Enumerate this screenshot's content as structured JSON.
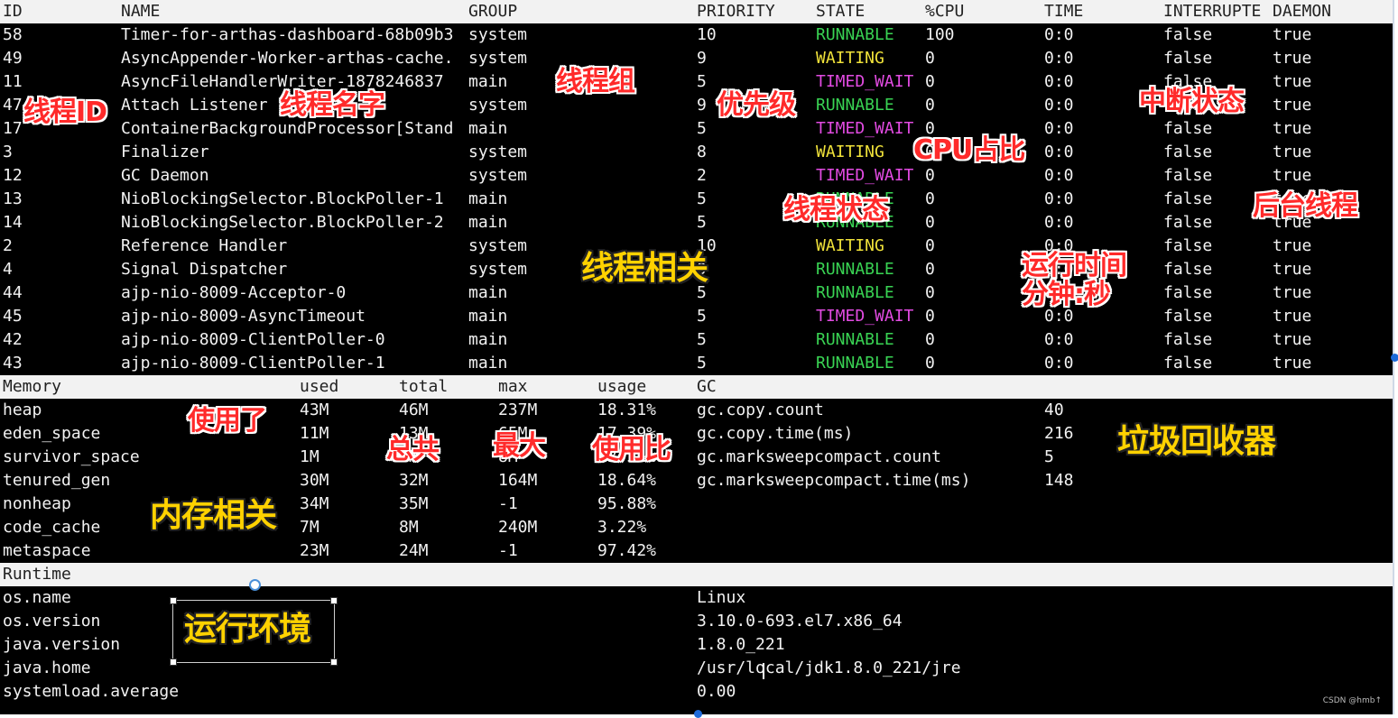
{
  "thread_header": [
    "ID",
    "NAME",
    "GROUP",
    "PRIORITY",
    "STATE",
    "%CPU",
    "TIME",
    "INTERRUPTE",
    "DAEMON"
  ],
  "threads": [
    {
      "id": "58",
      "name": "Timer-for-arthas-dashboard-68b09b3",
      "group": "system",
      "priority": "10",
      "state": "RUNNABLE",
      "cpu": "100",
      "time": "0:0",
      "interrupted": "false",
      "daemon": "true"
    },
    {
      "id": "49",
      "name": "AsyncAppender-Worker-arthas-cache.",
      "group": "system",
      "priority": "9",
      "state": "WAITING",
      "cpu": "0",
      "time": "0:0",
      "interrupted": "false",
      "daemon": "true"
    },
    {
      "id": "11",
      "name": "AsyncFileHandlerWriter-1878246837",
      "group": "main",
      "priority": "5",
      "state": "TIMED_WAIT",
      "cpu": "0",
      "time": "0:0",
      "interrupted": "false",
      "daemon": "true"
    },
    {
      "id": "47",
      "name": "Attach Listener",
      "group": "system",
      "priority": "9",
      "state": "RUNNABLE",
      "cpu": "0",
      "time": "0:0",
      "interrupted": "false",
      "daemon": "true"
    },
    {
      "id": "17",
      "name": "ContainerBackgroundProcessor[Stand",
      "group": "main",
      "priority": "5",
      "state": "TIMED_WAIT",
      "cpu": "0",
      "time": "0:0",
      "interrupted": "false",
      "daemon": "true"
    },
    {
      "id": "3",
      "name": "Finalizer",
      "group": "system",
      "priority": "8",
      "state": "WAITING",
      "cpu": "0",
      "time": "0:0",
      "interrupted": "false",
      "daemon": "true"
    },
    {
      "id": "12",
      "name": "GC Daemon",
      "group": "system",
      "priority": "2",
      "state": "TIMED_WAIT",
      "cpu": "0",
      "time": "0:0",
      "interrupted": "false",
      "daemon": "true"
    },
    {
      "id": "13",
      "name": "NioBlockingSelector.BlockPoller-1",
      "group": "main",
      "priority": "5",
      "state": "RUNNABLE",
      "cpu": "0",
      "time": "0:0",
      "interrupted": "false",
      "daemon": "true"
    },
    {
      "id": "14",
      "name": "NioBlockingSelector.BlockPoller-2",
      "group": "main",
      "priority": "5",
      "state": "RUNNABLE",
      "cpu": "0",
      "time": "0:0",
      "interrupted": "false",
      "daemon": "true"
    },
    {
      "id": "2",
      "name": "Reference Handler",
      "group": "system",
      "priority": "10",
      "state": "WAITING",
      "cpu": "0",
      "time": "0:0",
      "interrupted": "false",
      "daemon": "true"
    },
    {
      "id": "4",
      "name": "Signal Dispatcher",
      "group": "system",
      "priority": "9",
      "state": "RUNNABLE",
      "cpu": "0",
      "time": "0:0",
      "interrupted": "false",
      "daemon": "true"
    },
    {
      "id": "44",
      "name": "ajp-nio-8009-Acceptor-0",
      "group": "main",
      "priority": "5",
      "state": "RUNNABLE",
      "cpu": "0",
      "time": "0:0",
      "interrupted": "false",
      "daemon": "true"
    },
    {
      "id": "45",
      "name": "ajp-nio-8009-AsyncTimeout",
      "group": "main",
      "priority": "5",
      "state": "TIMED_WAIT",
      "cpu": "0",
      "time": "0:0",
      "interrupted": "false",
      "daemon": "true"
    },
    {
      "id": "42",
      "name": "ajp-nio-8009-ClientPoller-0",
      "group": "main",
      "priority": "5",
      "state": "RUNNABLE",
      "cpu": "0",
      "time": "0:0",
      "interrupted": "false",
      "daemon": "true"
    },
    {
      "id": "43",
      "name": "ajp-nio-8009-ClientPoller-1",
      "group": "main",
      "priority": "5",
      "state": "RUNNABLE",
      "cpu": "0",
      "time": "0:0",
      "interrupted": "false",
      "daemon": "true"
    }
  ],
  "memory_header": [
    "Memory",
    "used",
    "total",
    "max",
    "usage",
    "GC"
  ],
  "memory": [
    {
      "name": "heap",
      "used": "43M",
      "total": "46M",
      "max": "237M",
      "usage": "18.31%"
    },
    {
      "name": "eden_space",
      "used": "11M",
      "total": "13M",
      "max": "65M",
      "usage": "17.39%"
    },
    {
      "name": "survivor_space",
      "used": "1M",
      "total": "1M",
      "max": "8M",
      "usage": "13.31%"
    },
    {
      "name": "tenured_gen",
      "used": "30M",
      "total": "32M",
      "max": "164M",
      "usage": "18.64%"
    },
    {
      "name": "nonheap",
      "used": "34M",
      "total": "35M",
      "max": "-1",
      "usage": "95.88%"
    },
    {
      "name": "code_cache",
      "used": "7M",
      "total": "8M",
      "max": "240M",
      "usage": "3.22%"
    },
    {
      "name": "metaspace",
      "used": "23M",
      "total": "24M",
      "max": "-1",
      "usage": "97.42%"
    }
  ],
  "gc": [
    {
      "name": "gc.copy.count",
      "value": "40"
    },
    {
      "name": "gc.copy.time(ms)",
      "value": "216"
    },
    {
      "name": "gc.marksweepcompact.count",
      "value": "5"
    },
    {
      "name": "gc.marksweepcompact.time(ms)",
      "value": "148"
    }
  ],
  "runtime_header": "Runtime",
  "runtime": [
    {
      "key": "os.name",
      "value": "Linux"
    },
    {
      "key": "os.version",
      "value": "3.10.0-693.el7.x86_64"
    },
    {
      "key": "java.version",
      "value": "1.8.0_221"
    },
    {
      "key": "java.home",
      "value": "/usr/local/jdk1.8.0_221/jre"
    },
    {
      "key": "systemload.average",
      "value": "0.00"
    }
  ],
  "annotations": {
    "thread_id": "线程ID",
    "thread_name": "线程名字",
    "thread_group": "线程组",
    "priority": "优先级",
    "interrupt_state": "中断状态",
    "cpu_ratio": "CPU占比",
    "daemon_thread": "后台线程",
    "thread_state": "线程状态",
    "thread_related": "线程相关",
    "run_time": "运行时间",
    "minute_second": "分钟:秒",
    "used": "使用了",
    "total": "总共",
    "max": "最大",
    "usage_ratio": "使用比",
    "gc_collector": "垃圾回收器",
    "memory_related": "内存相关",
    "runtime_env": "运行环境"
  },
  "watermark": "CSDN @hmb↑",
  "colors": {
    "runnable": "#39d353",
    "waiting": "#f0e23a",
    "timed_wait": "#e24be2"
  }
}
